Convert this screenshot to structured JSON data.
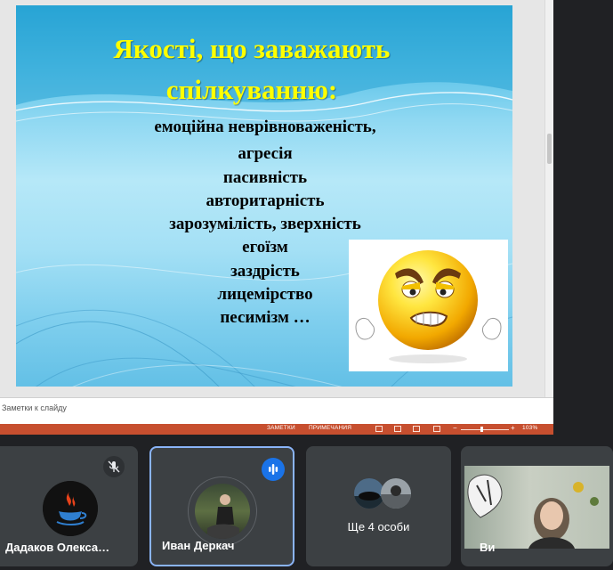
{
  "slide": {
    "title_line1": "Якості, що заважають",
    "title_line2": "спілкуванню:",
    "items": [
      "емоційна неврівноваженість,",
      "агресія",
      "пасивність",
      "авторитарність",
      "зарозумілість, зверхність",
      "егоїзм",
      "заздрість",
      "лицемірство",
      "песимізм …"
    ]
  },
  "notes_placeholder": "Заметки к слайду",
  "statusbar": {
    "notes_label": "ЗАМЕТКИ",
    "comments_label": "ПРИМЕЧАНИЯ",
    "zoom": "103%"
  },
  "participants": [
    {
      "name": "Дадаков Олекса…",
      "muted": true
    },
    {
      "name": "Иван Деркач",
      "speaking": true
    },
    {
      "name": "Ще 4 особи"
    },
    {
      "name": "Ви"
    }
  ],
  "colors": {
    "title": "#ffff00",
    "statusbar": "#c74f2f",
    "tile": "#3c4043",
    "active_border": "#8ab4f8",
    "speaking": "#1a73e8"
  }
}
